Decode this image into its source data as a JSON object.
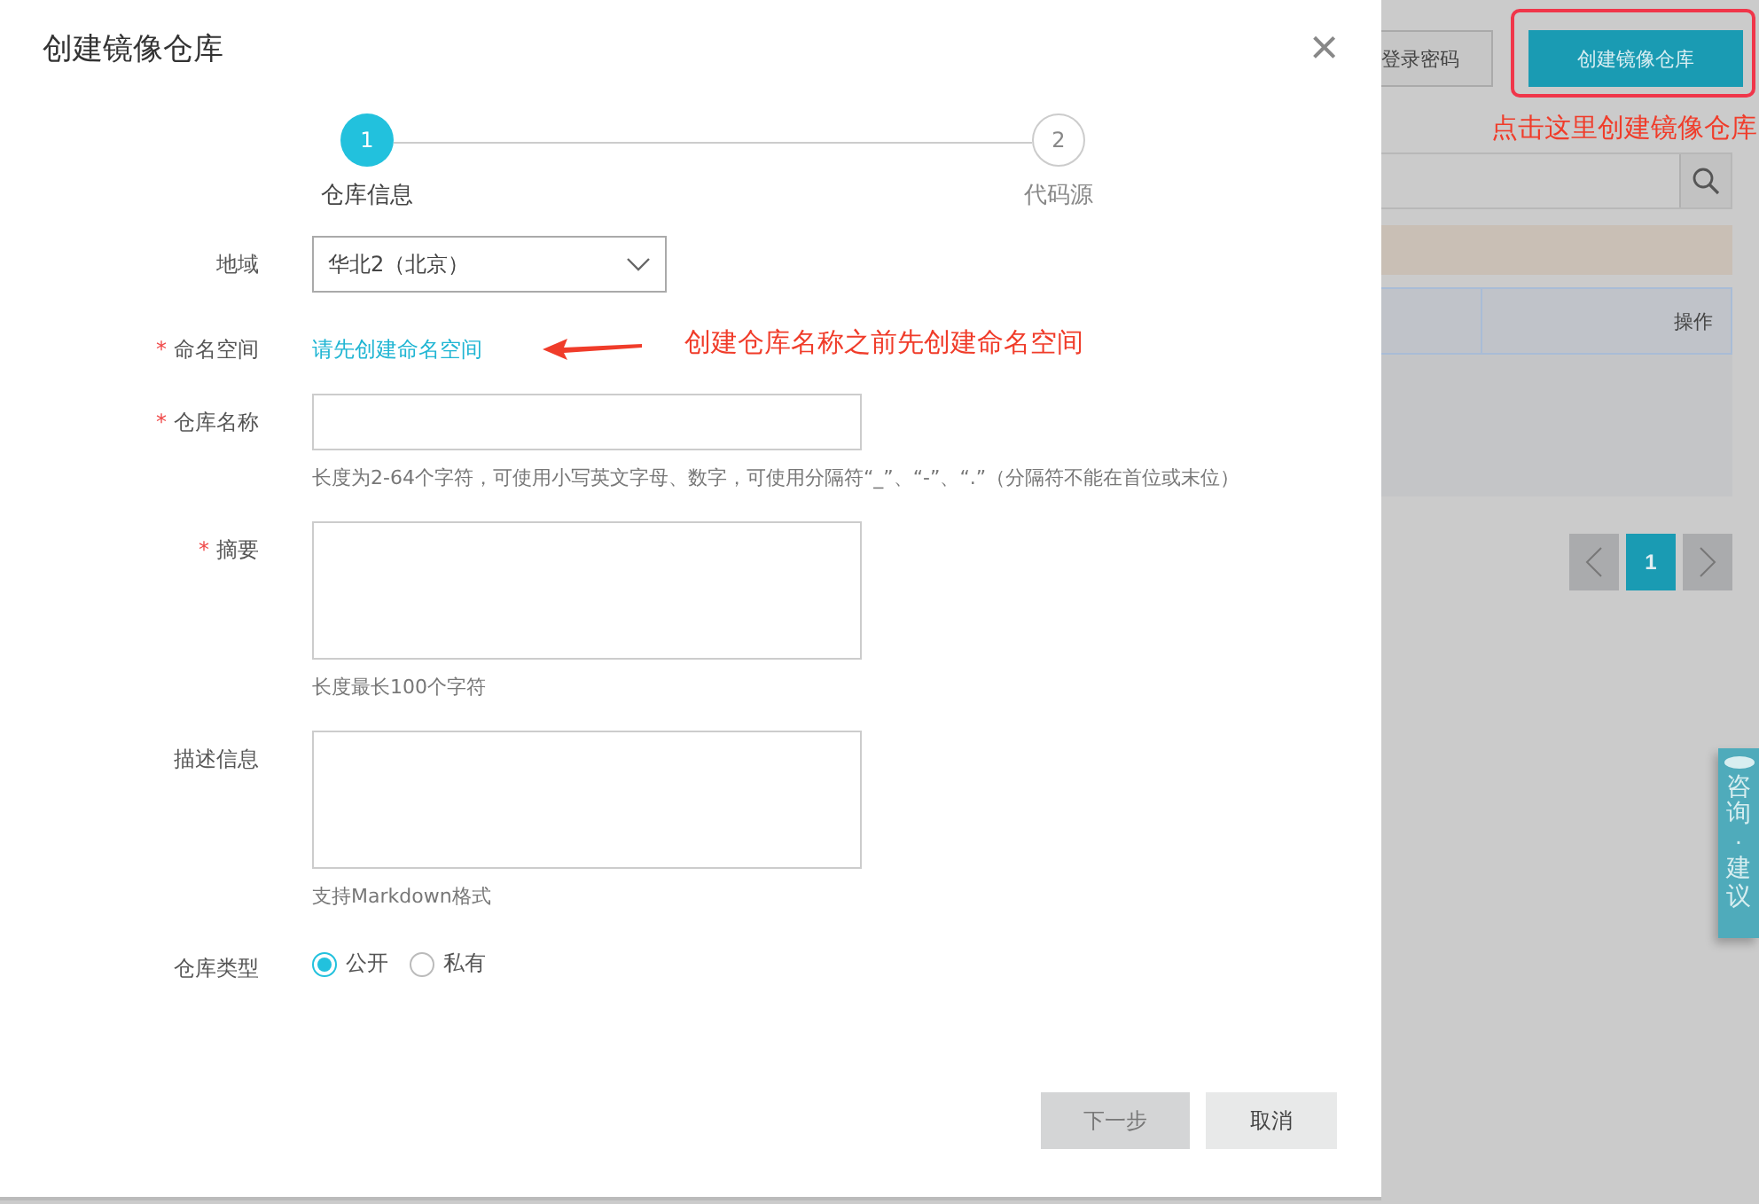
{
  "dialog": {
    "title": "创建镜像仓库",
    "close": "×",
    "steps": [
      {
        "number": "1",
        "label": "仓库信息",
        "selected": true
      },
      {
        "number": "2",
        "label": "代码源",
        "selected": false
      }
    ],
    "fields": [
      {
        "kind": "select",
        "label": "地域",
        "value": "华北2（北京）"
      },
      {
        "kind": "link",
        "label": "命名空间",
        "mark": "*",
        "link": "请先创建命名空间",
        "annotation": "创建仓库名称之前先创建命名空间"
      },
      {
        "kind": "input",
        "label": "仓库名称",
        "mark": "*",
        "hint": "长度为2-64个字符，可使用小写英文字母、数字，可使用分隔符“_”、“-”、“.”（分隔符不能在首位或末位）"
      },
      {
        "kind": "textarea",
        "label": "摘要",
        "mark": "*",
        "hint": "长度最长100个字符"
      },
      {
        "kind": "textarea",
        "label": "描述信息",
        "hint": "支持Markdown格式"
      },
      {
        "kind": "radio",
        "label": "仓库类型",
        "options": [
          {
            "label": "公开",
            "selected": true
          },
          {
            "label": "私有",
            "selected": false
          }
        ]
      }
    ],
    "buttons": [
      {
        "label": "下一步",
        "disabled": true
      },
      {
        "label": "取消",
        "disabled": false
      }
    ]
  },
  "background": {
    "password_button": "登录密码",
    "create_button": "创建镜像仓库",
    "annotation": "点击这里创建镜像仓库",
    "table": {
      "columns": [
        "操作"
      ]
    },
    "pagination": [
      {
        "label": "1",
        "selected": true
      }
    ],
    "feedback_tab": "咨询·建议"
  }
}
